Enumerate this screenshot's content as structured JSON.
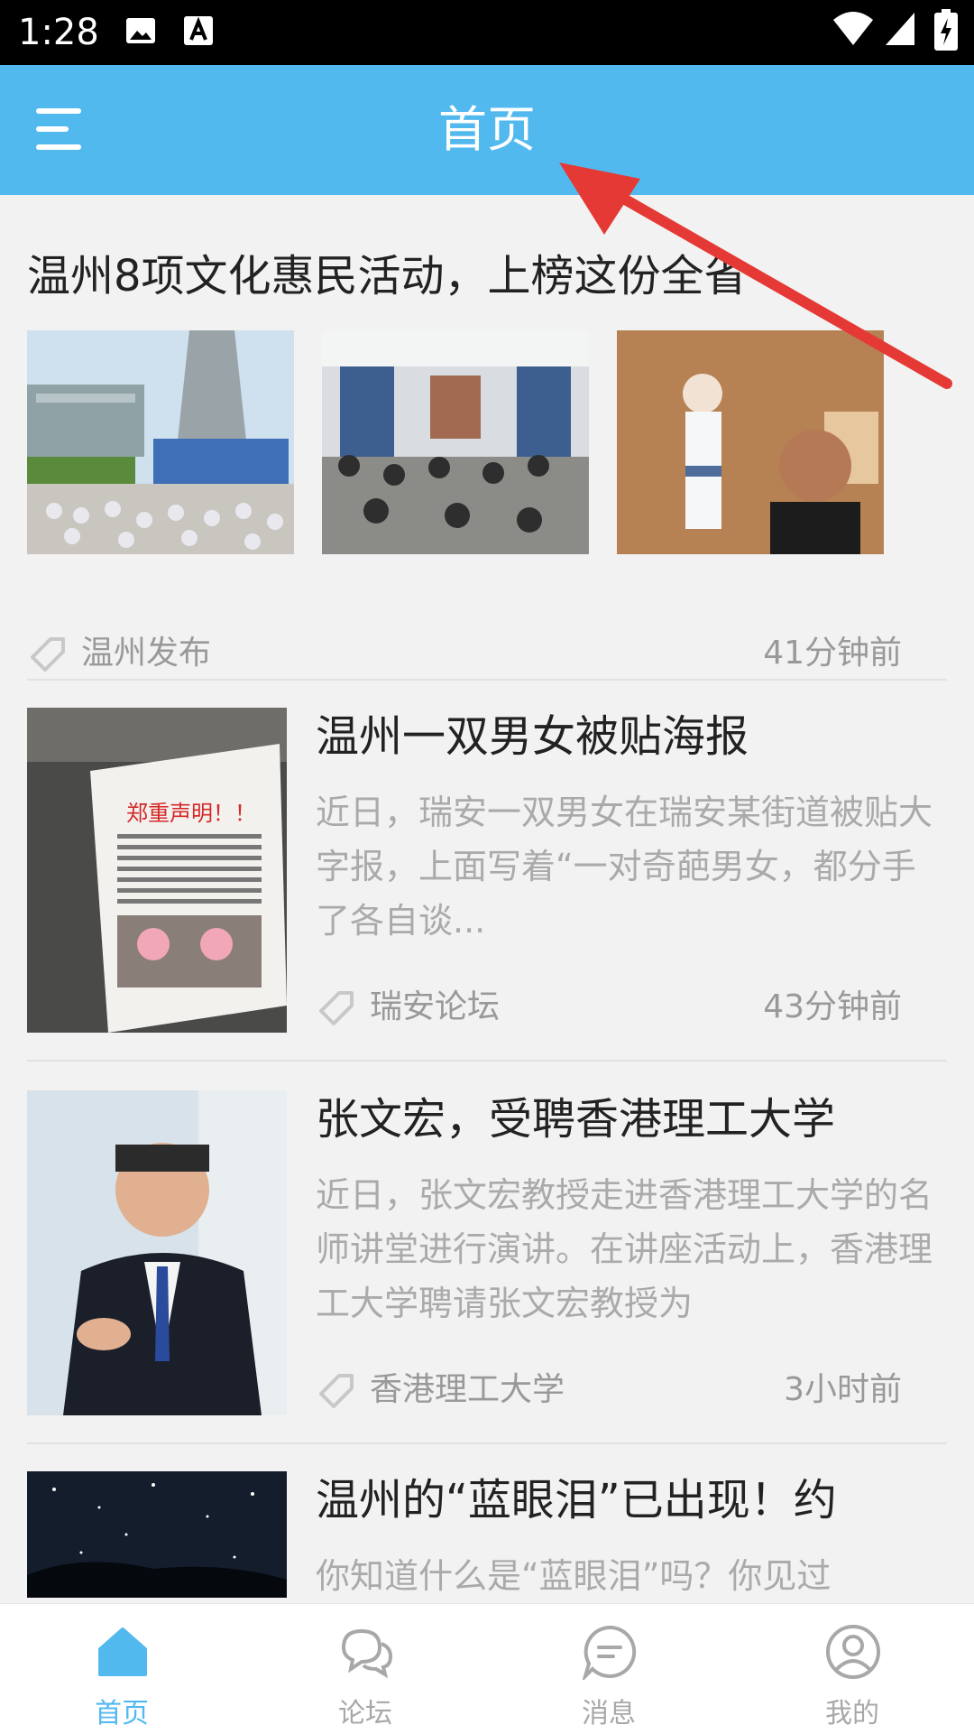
{
  "status_bar": {
    "time": "1:28"
  },
  "header": {
    "title": "首页"
  },
  "feed": {
    "items": [
      {
        "title": "温州8项文化惠民活动，上榜这份全省",
        "source": "温州发布",
        "time": "41分钟前"
      },
      {
        "title": "温州一双男女被贴海报",
        "excerpt": "近日，瑞安一双男女在瑞安某街道被贴大字报，上面写着“一对奇葩男女，都分手了各自谈...",
        "source": "瑞安论坛",
        "time": "43分钟前",
        "image_text": "郑重声明！！"
      },
      {
        "title": "张文宏，受聘香港理工大学",
        "excerpt": "近日，张文宏教授走进香港理工大学的名师讲堂进行演讲。在讲座活动上，香港理工大学聘请张文宏教授为",
        "source": "香港理工大学",
        "time": "3小时前"
      },
      {
        "title": "温州的“蓝眼泪”已出现！约",
        "excerpt": "你知道什么是“蓝眼泪”吗？你见过"
      }
    ]
  },
  "bottom_nav": {
    "items": [
      {
        "label": "首页",
        "icon": "home-icon",
        "active": true
      },
      {
        "label": "论坛",
        "icon": "forum-icon",
        "active": false
      },
      {
        "label": "消息",
        "icon": "message-icon",
        "active": false
      },
      {
        "label": "我的",
        "icon": "profile-icon",
        "active": false
      }
    ]
  },
  "colors": {
    "accent": "#52b9ef",
    "status_bar": "#000000",
    "annotation_arrow": "#e53935"
  }
}
